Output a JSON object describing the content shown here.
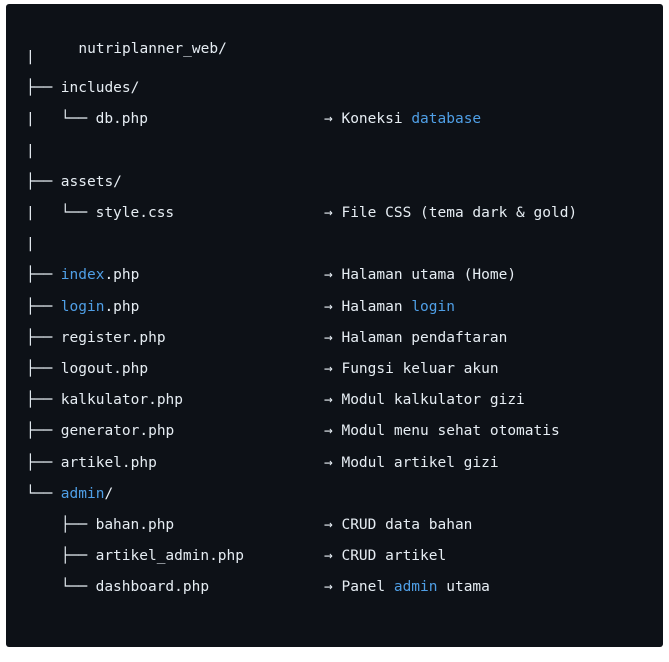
{
  "root": "nutriplanner_web/",
  "rows": [
    {
      "prefix": "|",
      "name": [],
      "desc": []
    },
    {
      "prefix": "├── ",
      "name": [
        {
          "t": "includes/"
        }
      ],
      "desc": []
    },
    {
      "prefix": "|   └── ",
      "name": [
        {
          "t": "db.php"
        }
      ],
      "desc": [
        {
          "t": "→ Koneksi "
        },
        {
          "t": "database",
          "hl": true
        }
      ]
    },
    {
      "prefix": "|",
      "name": [],
      "desc": []
    },
    {
      "prefix": "├── ",
      "name": [
        {
          "t": "assets/"
        }
      ],
      "desc": []
    },
    {
      "prefix": "|   └── ",
      "name": [
        {
          "t": "style.css"
        }
      ],
      "desc": [
        {
          "t": "→ File CSS (tema dark & gold)"
        }
      ]
    },
    {
      "prefix": "|",
      "name": [],
      "desc": []
    },
    {
      "prefix": "├── ",
      "name": [
        {
          "t": "index",
          "hl": true
        },
        {
          "t": ".php"
        }
      ],
      "desc": [
        {
          "t": "→ Halaman utama (Home)"
        }
      ]
    },
    {
      "prefix": "├── ",
      "name": [
        {
          "t": "login",
          "hl": true
        },
        {
          "t": ".php"
        }
      ],
      "desc": [
        {
          "t": "→ Halaman "
        },
        {
          "t": "login",
          "hl": true
        }
      ]
    },
    {
      "prefix": "├── ",
      "name": [
        {
          "t": "register.php"
        }
      ],
      "desc": [
        {
          "t": "→ Halaman pendaftaran"
        }
      ]
    },
    {
      "prefix": "├── ",
      "name": [
        {
          "t": "logout.php"
        }
      ],
      "desc": [
        {
          "t": "→ Fungsi keluar akun"
        }
      ]
    },
    {
      "prefix": "├── ",
      "name": [
        {
          "t": "kalkulator.php"
        }
      ],
      "desc": [
        {
          "t": "→ Modul kalkulator gizi"
        }
      ]
    },
    {
      "prefix": "├── ",
      "name": [
        {
          "t": "generator.php"
        }
      ],
      "desc": [
        {
          "t": "→ Modul menu sehat otomatis"
        }
      ]
    },
    {
      "prefix": "├── ",
      "name": [
        {
          "t": "artikel.php"
        }
      ],
      "desc": [
        {
          "t": "→ Modul artikel gizi"
        }
      ]
    },
    {
      "prefix": "└── ",
      "name": [
        {
          "t": "admin",
          "hl": true
        },
        {
          "t": "/"
        }
      ],
      "desc": []
    },
    {
      "prefix": "    ├── ",
      "name": [
        {
          "t": "bahan.php"
        }
      ],
      "desc": [
        {
          "t": "→ CRUD data bahan"
        }
      ]
    },
    {
      "prefix": "    ├── ",
      "name": [
        {
          "t": "artikel_admin.php"
        }
      ],
      "desc": [
        {
          "t": "→ CRUD artikel"
        }
      ]
    },
    {
      "prefix": "    └── ",
      "name": [
        {
          "t": "dashboard.php"
        }
      ],
      "desc": [
        {
          "t": "→ Panel "
        },
        {
          "t": "admin",
          "hl": true
        },
        {
          "t": " utama"
        }
      ]
    }
  ],
  "colors": {
    "background": "#0d1117",
    "text": "#e6edf3",
    "highlight": "#4f9fe6"
  }
}
